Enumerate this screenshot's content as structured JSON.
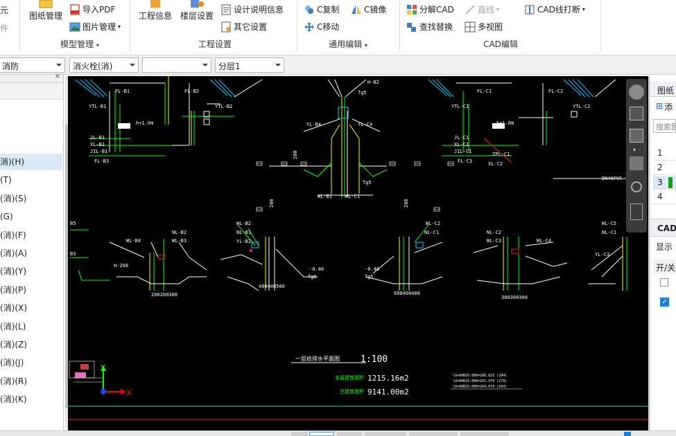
{
  "ribbon": {
    "partial_left_top": "元",
    "partial_left_mid": "件",
    "drawing_mgmt": "图纸管理",
    "import_pdf": "导入PDF",
    "image_mgmt": "图片管理",
    "group_model": "模型管理",
    "project_info": "工程信息",
    "floor_settings": "楼层设置",
    "design_notes": "设计说明信息",
    "other_settings": "其它设置",
    "group_project": "工程设置",
    "c_copy": "C复制",
    "c_mirror": "C镜像",
    "c_move": "C移动",
    "group_edit": "通用编辑",
    "explode_cad": "分解CAD",
    "line_tool": "直线",
    "cad_line_break": "CAD线打断",
    "find_replace": "查找替换",
    "multi_view": "多视图",
    "group_cad": "CAD编辑"
  },
  "toolbar2": {
    "combo1": "消防",
    "combo2": "消火栓(消)",
    "combo3": "",
    "combo4": "分层1"
  },
  "left_panel": {
    "items": [
      "消)(H)",
      "(T)",
      "(消)(S)",
      "(G)",
      "(消)(F)",
      "(消)(A)",
      "(消)(Y)",
      "(消)(P)",
      "(消)(X)",
      "(消)(L)",
      "(消)(Z)",
      "(消)(J)",
      "(消)(R)",
      "(消)(K)"
    ]
  },
  "right_panel": {
    "header": "图纸",
    "add": "添",
    "search": "搜索图",
    "rows": [
      "1",
      "2",
      "3",
      "4"
    ],
    "cad_header": "CAD",
    "show": "显示",
    "on_off": "开/关"
  },
  "cad": {
    "title": "一层给排水平面图",
    "scale": "1:100",
    "area_label_1": "本层建筑面积",
    "area_value_1": "1215.16m2",
    "area_label_2": "总建筑面积",
    "area_value_2": "9141.00m2",
    "elev_1": "\\U+00B10.000=260.825 (284)",
    "elev_2": "\\U+00B10.000=261.970 (278)",
    "elev_3": "\\U+00B10.000=264.070 (264)",
    "axis_x": "X",
    "axis_y": "Y",
    "labels": {
      "fl_b1": "FL-B1",
      "fl_b2": "FL-B2",
      "fl_c1": "FL-C1",
      "fl_c2": "FL-C2",
      "ytl_b1": "YTL-B1",
      "ytl_b2": "YTL-B2",
      "ytl_c1": "YTL-C1",
      "ytl_c2": "YTL-C2",
      "h1": "h+1.0m",
      "h2": "h+1.0m",
      "jl_b1": "JL-B1",
      "xl_b1": "XL-B1",
      "jil_b1": "JIL-B1",
      "fl_b3": "FL-B3",
      "jl_c1": "JL-C1",
      "xl_c1": "XL-C1",
      "jil_c1": "JIL-C1",
      "fl_c3": "FL-C3",
      "zpl_c1": "ZPL-C1",
      "xl_c2": "XL-C2",
      "yl_b4": "YL-B4",
      "yl_c4": "YL-C4",
      "wl_b1": "WL-B1",
      "wl_c1": "WL-C1",
      "tg5a": "Tg5",
      "tg5b": "Tg5",
      "tg5c": "Tg5",
      "tg5d": "Tg5",
      "h202": "H-B2",
      "dn40": "DN40PVC",
      "wl_b2": "WL-B2",
      "nl_b1": "NL-B1",
      "yl_b2": "YL-B2",
      "wl_c2": "WL-C2",
      "nl_c1": "NL-C1",
      "wl_b4": "WL-B4",
      "nl_b2": "NL-B2",
      "nl_b3": "WL-B3",
      "nl_c2": "NL-C2",
      "wl_c3": "WL-C3",
      "wl_c4": "WL-C4",
      "wl_c5": "WL-C5",
      "nl_c1b": "NL-C1",
      "yl_c3": "YL-C3",
      "b5": "B5",
      "b3": "B3",
      "h200": "H-200",
      "neg040a": "-0.40",
      "neg040b": "-0.40",
      "dim1": "200200300",
      "dim2": "400400500",
      "dim3": "600400400",
      "dim4": "300300300",
      "v200": "200",
      "v200b": "200",
      "v200c": "200"
    }
  }
}
